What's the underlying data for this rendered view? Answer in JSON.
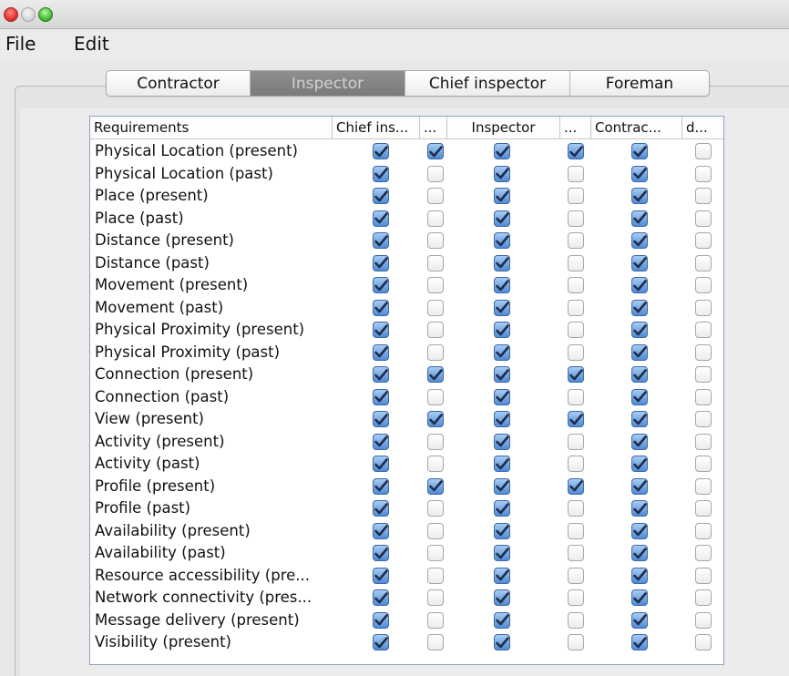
{
  "menu": {
    "file": "File",
    "edit": "Edit"
  },
  "tabs": [
    {
      "label": "Contractor",
      "active": false
    },
    {
      "label": "Inspector",
      "active": true
    },
    {
      "label": "Chief inspector",
      "active": false
    },
    {
      "label": "Foreman",
      "active": false
    }
  ],
  "table": {
    "headers": [
      "Requirements",
      "Chief ins...",
      "...",
      "Inspector",
      "...",
      "Contrac...",
      "d..."
    ],
    "rows": [
      {
        "label": "Physical Location (present)",
        "checks": [
          true,
          true,
          true,
          true,
          true,
          false
        ]
      },
      {
        "label": "Physical Location (past)",
        "checks": [
          true,
          false,
          true,
          false,
          true,
          false
        ]
      },
      {
        "label": "Place (present)",
        "checks": [
          true,
          false,
          true,
          false,
          true,
          false
        ]
      },
      {
        "label": "Place (past)",
        "checks": [
          true,
          false,
          true,
          false,
          true,
          false
        ]
      },
      {
        "label": "Distance (present)",
        "checks": [
          true,
          false,
          true,
          false,
          true,
          false
        ]
      },
      {
        "label": "Distance (past)",
        "checks": [
          true,
          false,
          true,
          false,
          true,
          false
        ]
      },
      {
        "label": "Movement (present)",
        "checks": [
          true,
          false,
          true,
          false,
          true,
          false
        ]
      },
      {
        "label": "Movement (past)",
        "checks": [
          true,
          false,
          true,
          false,
          true,
          false
        ]
      },
      {
        "label": "Physical Proximity (present)",
        "checks": [
          true,
          false,
          true,
          false,
          true,
          false
        ]
      },
      {
        "label": "Physical Proximity (past)",
        "checks": [
          true,
          false,
          true,
          false,
          true,
          false
        ]
      },
      {
        "label": "Connection (present)",
        "checks": [
          true,
          true,
          true,
          true,
          true,
          false
        ]
      },
      {
        "label": "Connection (past)",
        "checks": [
          true,
          false,
          true,
          false,
          true,
          false
        ]
      },
      {
        "label": "View (present)",
        "checks": [
          true,
          true,
          true,
          true,
          true,
          false
        ]
      },
      {
        "label": "Activity (present)",
        "checks": [
          true,
          false,
          true,
          false,
          true,
          false
        ]
      },
      {
        "label": "Activity (past)",
        "checks": [
          true,
          false,
          true,
          false,
          true,
          false
        ]
      },
      {
        "label": "Profile (present)",
        "checks": [
          true,
          true,
          true,
          true,
          true,
          false
        ]
      },
      {
        "label": "Profile (past)",
        "checks": [
          true,
          false,
          true,
          false,
          true,
          false
        ]
      },
      {
        "label": "Availability (present)",
        "checks": [
          true,
          false,
          true,
          false,
          true,
          false
        ]
      },
      {
        "label": "Availability (past)",
        "checks": [
          true,
          false,
          true,
          false,
          true,
          false
        ]
      },
      {
        "label": "Resource accessibility (pre...",
        "checks": [
          true,
          false,
          true,
          false,
          true,
          false
        ]
      },
      {
        "label": "Network connectivity (pres...",
        "checks": [
          true,
          false,
          true,
          false,
          true,
          false
        ]
      },
      {
        "label": "Message delivery (present)",
        "checks": [
          true,
          false,
          true,
          false,
          true,
          false
        ]
      },
      {
        "label": "Visibility (present)",
        "checks": [
          true,
          false,
          true,
          false,
          true,
          false
        ]
      }
    ]
  },
  "colors": {
    "accent": "#4f8bd6",
    "active_tab": "#7f7f7f",
    "table_border": "#8ea2c4"
  }
}
